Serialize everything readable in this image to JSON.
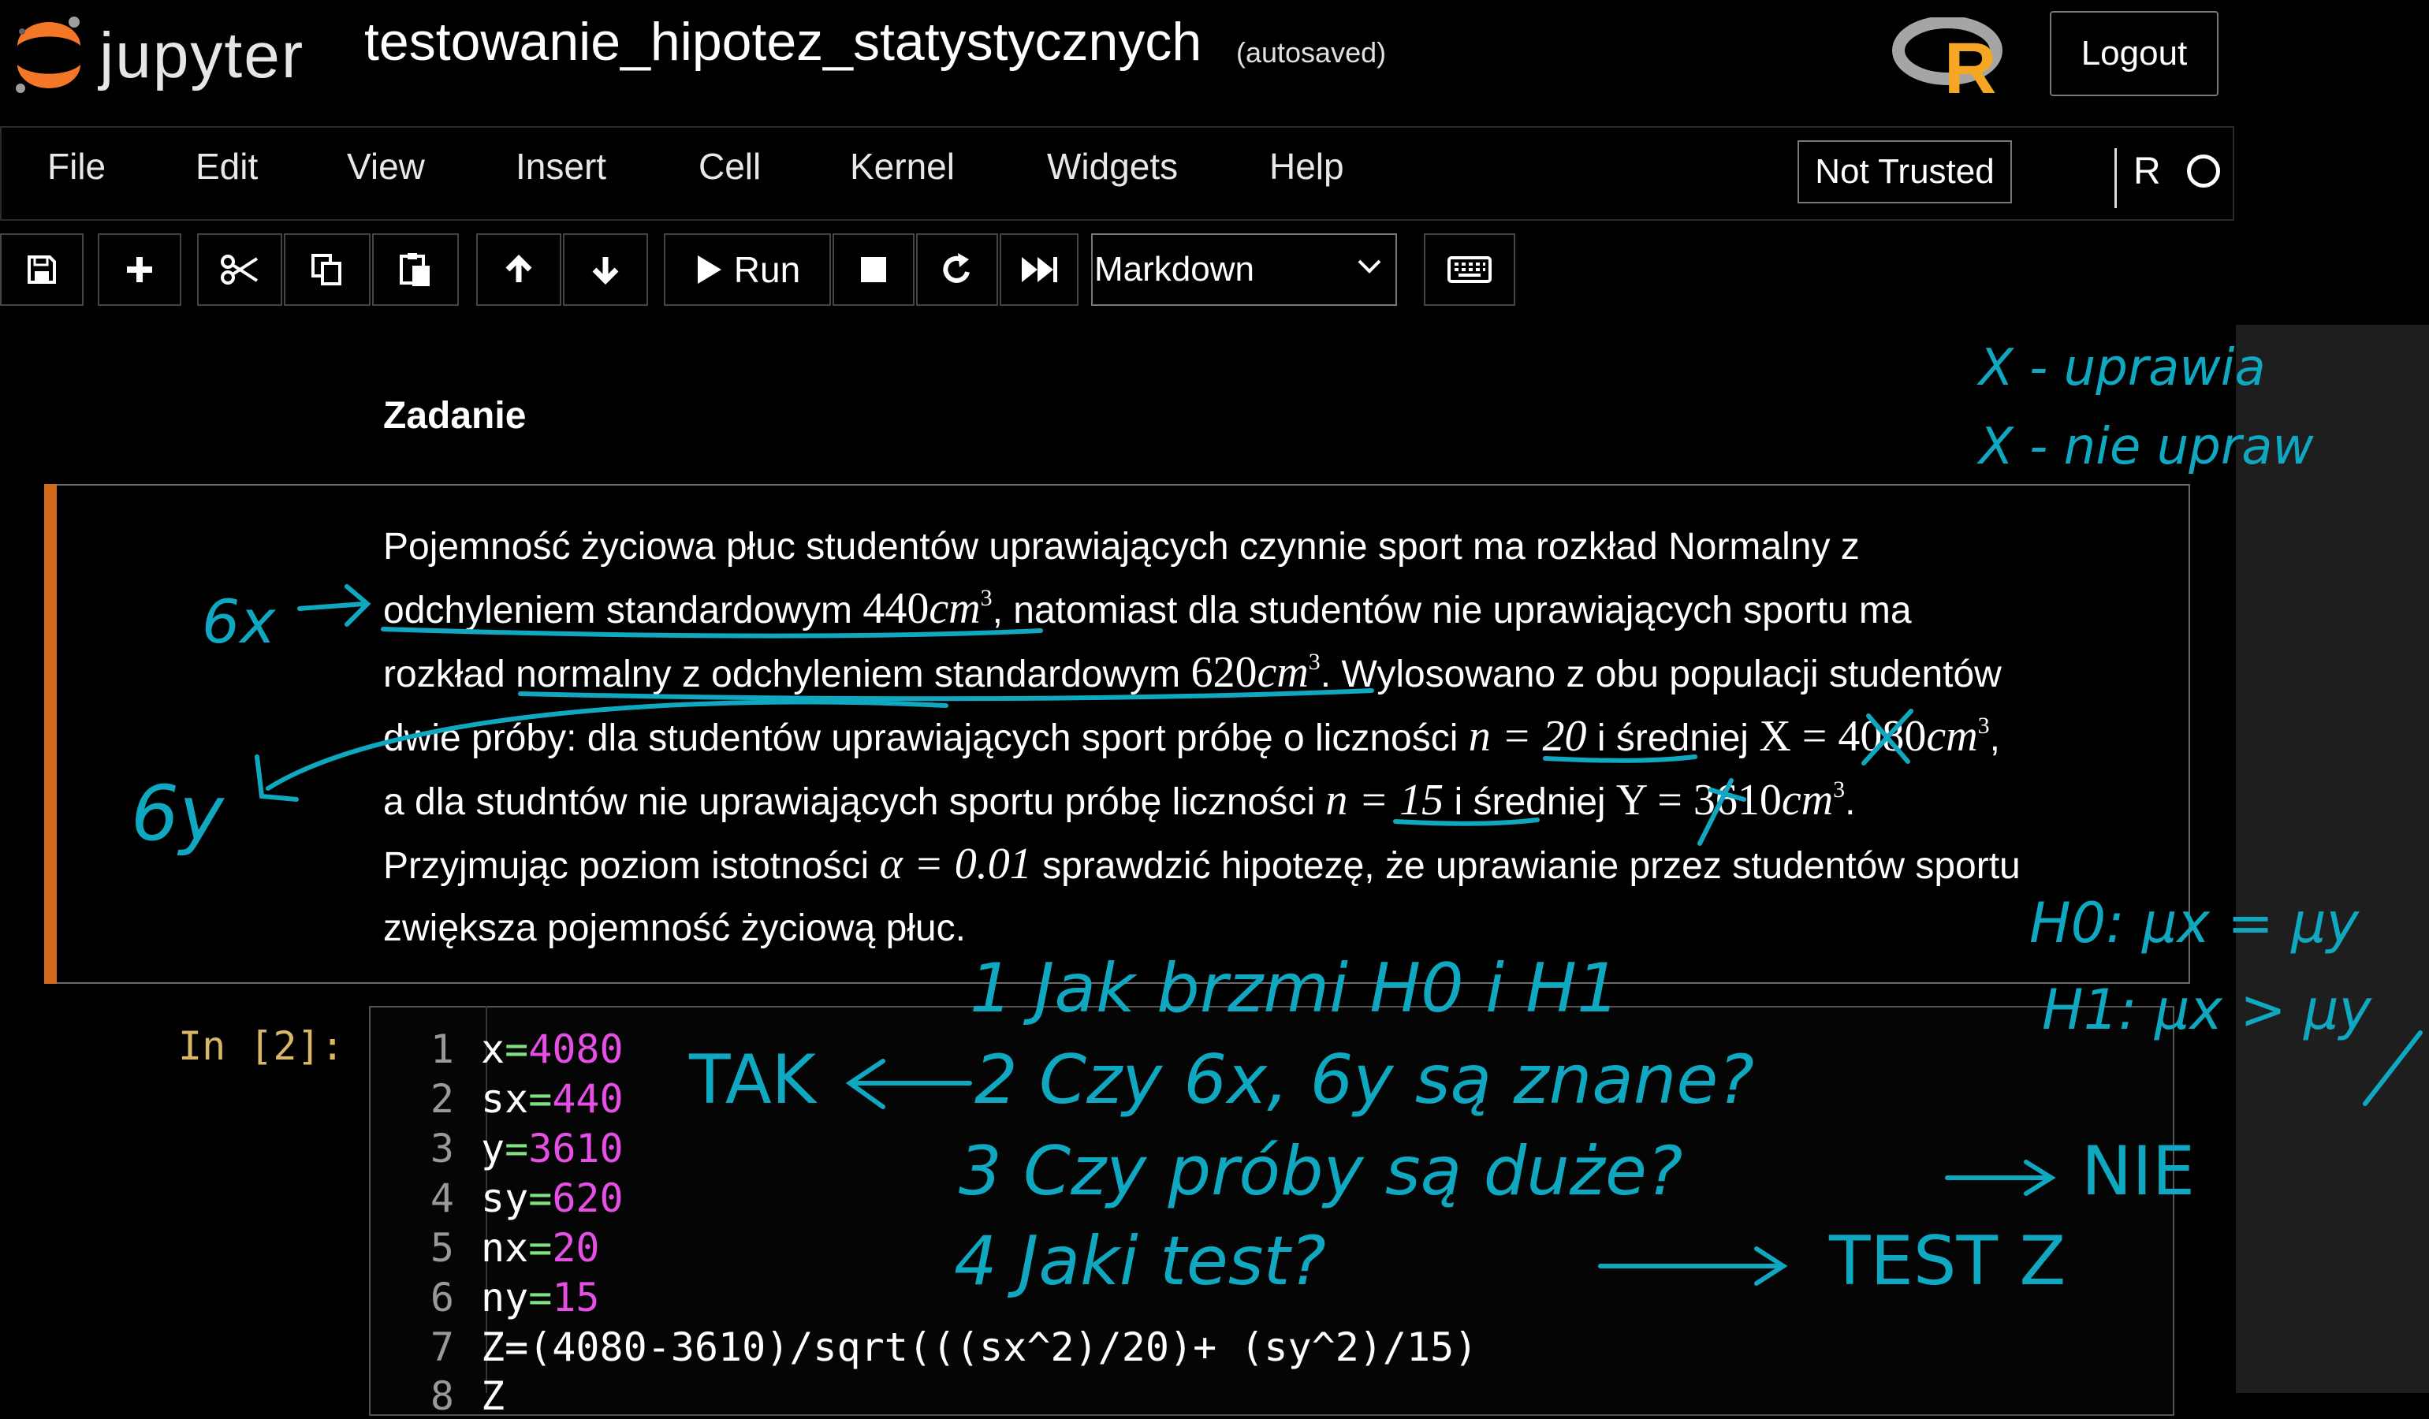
{
  "header": {
    "logo_text": "jupyter",
    "notebook_title": "testowanie_hipotez_statystycznych",
    "autosave_status": "(autosaved)",
    "r_logo_letter": "R",
    "logout_label": "Logout"
  },
  "menubar": {
    "items": [
      "File",
      "Edit",
      "View",
      "Insert",
      "Cell",
      "Kernel",
      "Widgets",
      "Help"
    ],
    "trust_status": "Not Trusted",
    "kernel_name": "R"
  },
  "toolbar": {
    "run_label": "Run",
    "cell_type": "Markdown",
    "icons": [
      "save-icon",
      "add-cell-icon",
      "cut-icon",
      "copy-icon",
      "paste-icon",
      "move-up-icon",
      "move-down-icon",
      "run-icon",
      "stop-icon",
      "restart-icon",
      "fast-forward-icon",
      "keyboard-icon"
    ]
  },
  "notebook": {
    "heading": "Zadanie",
    "problem": {
      "line1": "Pojemność życiowa płuc studentów uprawiających czynnie sport ma rozkład Normalny z",
      "line2a": "odchyleniem standardowym",
      "line2_math": "440",
      "line2_unit": "cm",
      "line2b": ", natomiast dla studentów nie uprawiających sportu ma",
      "line3a": "rozkład normalny z odchyleniem standardowym",
      "line3_math": "620",
      "line3b": ". Wylosowano z obu populacji studentów",
      "line4a": "dwie próby: dla studentów uprawiających sport próbę o liczności",
      "line4_n": "n = 20",
      "line4b": "i średniej",
      "line4_mean": "X = 4080",
      "line5a": "a dla studntów nie uprawiających sportu próbę liczności",
      "line5_n": "n = 15",
      "line5b": "i średniej",
      "line5_mean": "Y = 3610",
      "line6a": "Przyjmując poziom istotności",
      "line6_alpha": "α = 0.01",
      "line6b": "sprawdzić hipotezę, że uprawianie przez studentów sportu",
      "line7": "zwiększa pojemność życiową płuc."
    },
    "code_cell": {
      "prompt": "In [2]:",
      "line_numbers": [
        "1",
        "2",
        "3",
        "4",
        "5",
        "6",
        "7",
        "8"
      ],
      "lines": [
        {
          "name": "x",
          "value": "4080"
        },
        {
          "name": "sx",
          "value": "440"
        },
        {
          "name": "y",
          "value": "3610"
        },
        {
          "name": "sy",
          "value": "620"
        },
        {
          "name": "nx",
          "value": "20"
        },
        {
          "name": "ny",
          "value": "15"
        }
      ],
      "line7": "Z=(4080-3610)/sqrt(((sx^2)/20)+ (sy^2)/15)",
      "line8": "Z"
    }
  },
  "annotations": {
    "top_right_1": "X - uprawia",
    "top_right_2": "X - nie upraw",
    "sigma_x": "6x",
    "sigma_y": "6y",
    "h0": "H0: μx = μy",
    "h1": "H1: μx > μy",
    "step1": "1  Jak brzmi H0 i H1",
    "step2": "2  Czy 6x, 6y są znane?",
    "step2_answer": "TAK",
    "step3": "3  Czy próby są duże?",
    "step3_answer": "NIE",
    "step4": "4  Jaki test?",
    "step4_answer": "TEST Z"
  },
  "colors": {
    "background": "#000000",
    "cell_marker": "#d2691e",
    "ink": "#10a7c0",
    "number": "#e64fe6",
    "operator": "#7ee27e",
    "prompt": "#d8b866"
  }
}
